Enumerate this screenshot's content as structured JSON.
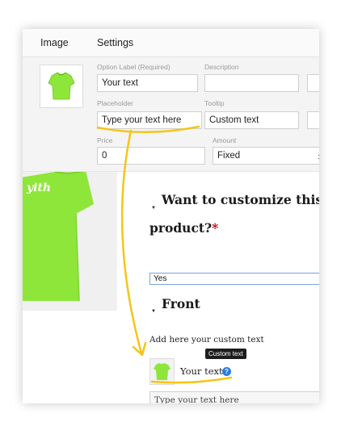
{
  "tabs": [
    "Image",
    "Settings"
  ],
  "option_label": {
    "label": "Option Label (Required)",
    "value": "Your text"
  },
  "description": {
    "label": "Description",
    "value": ""
  },
  "placeholder": {
    "label": "Placeholder",
    "value": "Type your text here"
  },
  "tooltip": {
    "label": "Tooltip",
    "value": "Custom text"
  },
  "price": {
    "label": "Price",
    "value": "0"
  },
  "amount": {
    "label": "Amount",
    "value": "Fixed"
  },
  "colors": {
    "shirt": "#8fe63a",
    "accent": "#f5c518",
    "help": "#2c7be0"
  },
  "front": {
    "question_line1": "Want to customize this",
    "question_line2": "product?",
    "required_mark": "*",
    "select_value": "Yes",
    "section_title": "Front",
    "instruction": "Add here your custom text",
    "tooltip_text": "Custom text",
    "option_label": "Your text",
    "help_icon": "?",
    "input_placeholder": "Type your text here"
  },
  "shirt_logo": "yith"
}
